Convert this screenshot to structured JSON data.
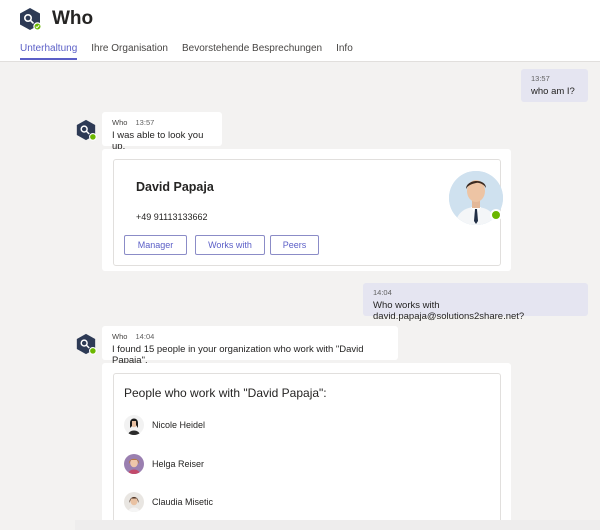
{
  "app": {
    "title": "Who",
    "avatar_icon": "who-bot-hexagon-icon"
  },
  "tabs": [
    {
      "label": "Unterhaltung",
      "active": true
    },
    {
      "label": "Ihre Organisation",
      "active": false
    },
    {
      "label": "Bevorstehende Besprechungen",
      "active": false
    },
    {
      "label": "Info",
      "active": false
    }
  ],
  "messages": {
    "m1": {
      "time": "13:57",
      "text": "who am I?"
    },
    "m2": {
      "sender": "Who",
      "time": "13:57",
      "text": "I was able to look you up."
    },
    "card1": {
      "name": "David Papaja",
      "phone": "+49 91113133662",
      "buttons": {
        "manager": "Manager",
        "works_with": "Works with",
        "peers": "Peers"
      }
    },
    "m3": {
      "time": "14:04",
      "text": "Who works with david.papaja@solutions2share.net?"
    },
    "m4": {
      "sender": "Who",
      "time": "14:04",
      "text": "I found 15 people in your organization who work with \"David Papaja\"."
    },
    "card2": {
      "title": "People who work with \"David Papaja\":",
      "people": [
        {
          "name": "Nicole Heidel"
        },
        {
          "name": "Helga Reiser"
        },
        {
          "name": "Claudia Misetic"
        }
      ]
    }
  },
  "colors": {
    "accent": "#5b5fc7",
    "presence": "#6bb700",
    "my_bubble": "#e5e5f1"
  }
}
